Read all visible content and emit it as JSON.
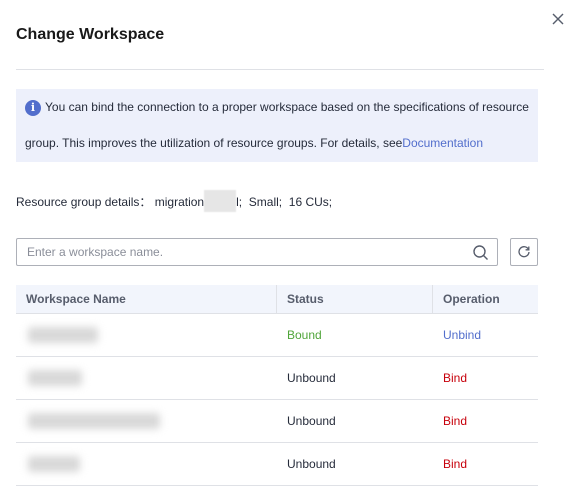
{
  "dialog": {
    "title": "Change Workspace",
    "close_icon": "close-icon"
  },
  "info": {
    "icon": "info-icon",
    "icon_glyph": "i",
    "line1": "You can bind the connection to a proper workspace based on the specifications of resource",
    "line2_text": "group. This improves the utilization of resource groups. For details, see",
    "link_label": "Documentation"
  },
  "resource_group": {
    "label": "Resource group details：",
    "name_prefix": "migration",
    "name_suffix": "l;",
    "flavor": "Small;",
    "cus": "16 CUs;"
  },
  "search": {
    "placeholder": "Enter a workspace name.",
    "value": "",
    "icon": "search-icon"
  },
  "refresh": {
    "icon": "refresh-icon"
  },
  "table": {
    "columns": [
      "Workspace Name",
      "Status",
      "Operation"
    ],
    "rows": [
      {
        "name": "",
        "status": "Bound",
        "operation": "Unbind"
      },
      {
        "name": "",
        "status": "Unbound",
        "operation": "Bind"
      },
      {
        "name": "",
        "status": "Unbound",
        "operation": "Bind"
      },
      {
        "name": "",
        "status": "Unbound",
        "operation": "Bind"
      }
    ]
  },
  "colors": {
    "link": "#526ecc",
    "bound": "#50a53a",
    "bind": "#c7000b",
    "info_bg": "#edf0fb",
    "header_bg": "#f2f5fc"
  }
}
